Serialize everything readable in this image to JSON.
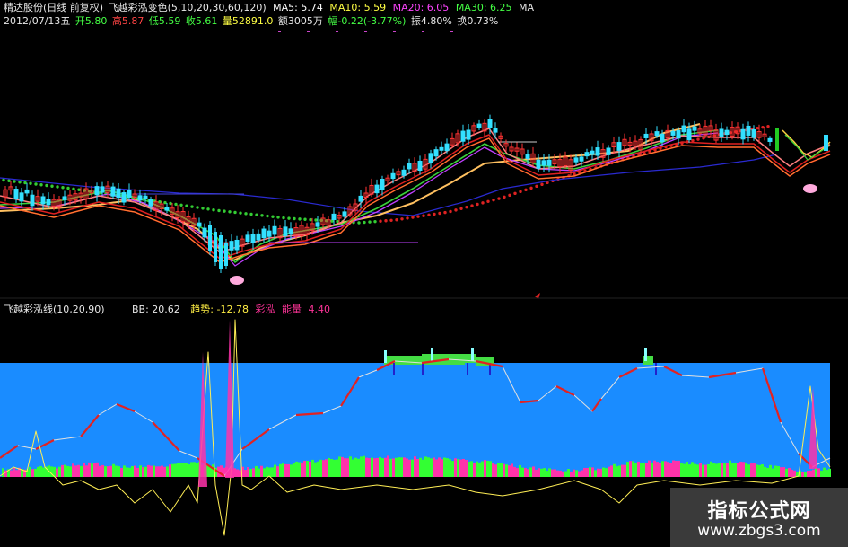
{
  "header": {
    "stock_name": "精达股份(日线 前复权)",
    "indicator_main": "飞越彩泓变色(5,10,20,30,60,120)",
    "ma5": "MA5: 5.74",
    "ma10": "MA10: 5.59",
    "ma20": "MA20: 6.05",
    "ma30": "MA30: 6.25",
    "ma_more": "MA",
    "date": "2012/07/13五",
    "open": "开5.80",
    "high": "高5.87",
    "low": "低5.59",
    "close": "收5.61",
    "volume": "量52891.0",
    "amount": "额3005万",
    "change": "幅-0.22(-3.77%)",
    "amplitude": "振4.80%",
    "turnover": "换0.73%",
    "sub_indicator": "飞越彩泓线(10,20,90)",
    "bb": "BB: 20.62",
    "trend": "趋势: -12.78",
    "rainbow": "彩泓",
    "energy": "能量",
    "energy_value": "4.40"
  },
  "watermark": {
    "title": "指标公式网",
    "url": "www.zbgs3.com"
  },
  "colors": {
    "background": "#000000",
    "band_fill": "#1a8cff",
    "up_candle": "#ff3333",
    "down_candle": "#33e0ff",
    "ma_fast": "#ff2020",
    "ma_mid": "#ffd080",
    "ma_slow": "#2020a0",
    "dot_green": "#33cc33",
    "dot_red": "#dd2222",
    "energy_green": "#33ff33",
    "energy_pink": "#ff33aa",
    "osc_yellow": "#ffee55",
    "osc_white": "#e0e0e0"
  },
  "chart_data": {
    "type": "line",
    "title": "飞越彩泓变色",
    "series_labels": [
      "MA5",
      "MA10",
      "MA20",
      "MA30"
    ],
    "last_values": {
      "MA5": 5.74,
      "MA10": 5.59,
      "MA20": 6.05,
      "MA30": 6.25
    },
    "ohlc_last": {
      "open": 5.8,
      "high": 5.87,
      "low": 5.59,
      "close": 5.61
    },
    "sub_chart": {
      "name": "飞越彩泓线",
      "params": [
        10,
        20,
        90
      ],
      "BB": 20.62,
      "trend": -12.78,
      "energy": 4.4
    }
  }
}
